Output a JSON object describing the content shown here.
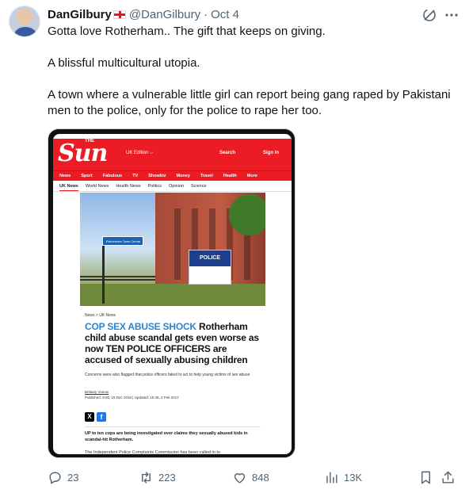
{
  "author": {
    "display_name": "DanGilbury",
    "flag_icon": "england-flag-icon",
    "handle": "@DanGilbury",
    "separator": "·",
    "date": "Oct 4"
  },
  "tweet": {
    "paragraphs": [
      "Gotta love Rotherham.. The gift that keeps on giving.",
      "A blissful multicultural utopia.",
      "A town where a vulnerable little girl can report being gang raped by Pakistani men to the police, only for the police to rape her too."
    ]
  },
  "media": {
    "site": {
      "logo": "Sun",
      "logo_prefix": "THE",
      "edition": "UK Edition ⌵",
      "search": "Search",
      "signin": "Sign in",
      "nav": [
        "News",
        "Sport",
        "Fabulous",
        "TV",
        "Showbiz",
        "Money",
        "Travel",
        "Health",
        "More"
      ],
      "subnav": [
        "UK News",
        "World News",
        "Health News",
        "Politics",
        "Opinion",
        "Science"
      ]
    },
    "photo": {
      "police_sign": "POLICE",
      "street_sign": "Rotherham Town Centre"
    },
    "article": {
      "breadcrumb": "News > UK News",
      "kicker": "COP SEX ABUSE SHOCK",
      "headline": "Rotherham child abuse scandal gets even worse as now TEN POLICE OFFICERS are accused of sexually abusing children",
      "standfirst": "Concerns were also flagged that police officers failed to act to help young victims of sex abuse",
      "byline": "Brittany Vonow",
      "published": "Published: 8:00, 15 Dec 2016 | Updated: 15:46, 2 Feb 2017",
      "share_x": "X",
      "share_fb": "f",
      "lead": "UP to ten cops are being investigated over claims they sexually abused kids in scandal-hit Rotherham.",
      "body_line": "The Independent Police Complaints Commission has been called in to"
    }
  },
  "actions": {
    "replies": "23",
    "reposts": "223",
    "likes": "848",
    "views": "13K"
  }
}
